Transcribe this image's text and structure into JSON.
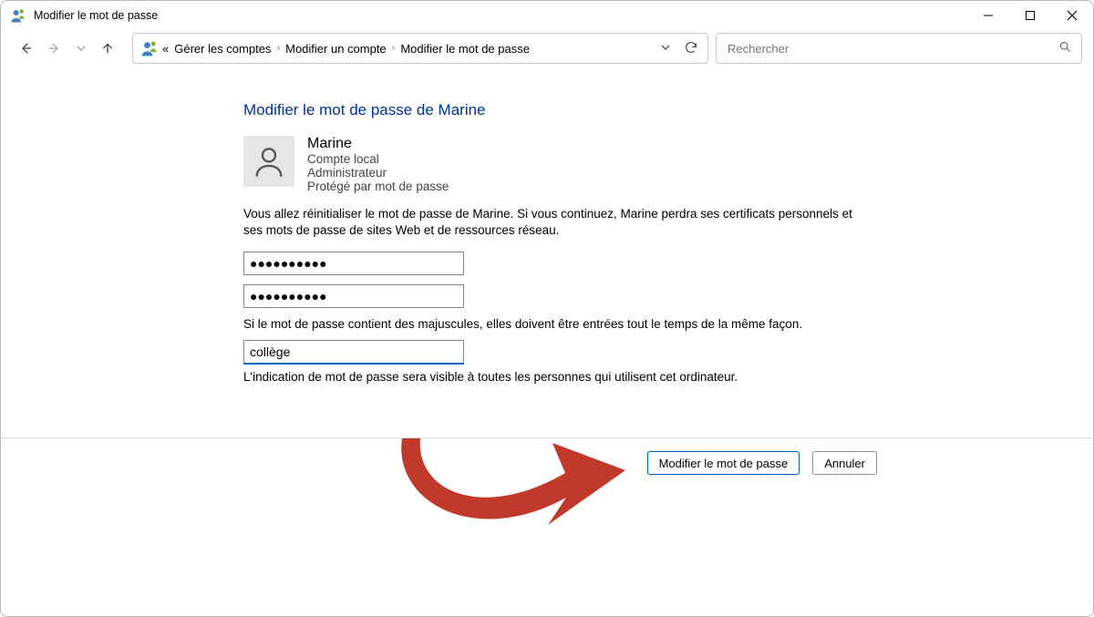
{
  "window": {
    "title": "Modifier le mot de passe"
  },
  "breadcrumb": {
    "prefix": "«",
    "items": [
      "Gérer les comptes",
      "Modifier un compte",
      "Modifier le mot de passe"
    ]
  },
  "search": {
    "placeholder": "Rechercher"
  },
  "page": {
    "heading": "Modifier le mot de passe de Marine",
    "account": {
      "name": "Marine",
      "type": "Compte local",
      "role": "Administrateur",
      "protection": "Protégé par mot de passe"
    },
    "warning": "Vous allez réinitialiser le mot de passe de Marine. Si vous continuez, Marine perdra ses certificats personnels et ses mots de passe de sites Web et de ressources réseau.",
    "password1": "●●●●●●●●●●",
    "password2": "●●●●●●●●●●",
    "caps_note": "Si le mot de passe contient des majuscules, elles doivent être entrées tout le temps de la même façon.",
    "hint_value": "collège",
    "hint_visibility": "L'indication de mot de passe sera visible à toutes les personnes qui utilisent cet ordinateur."
  },
  "buttons": {
    "primary": "Modifier le mot de passe",
    "cancel": "Annuler"
  }
}
